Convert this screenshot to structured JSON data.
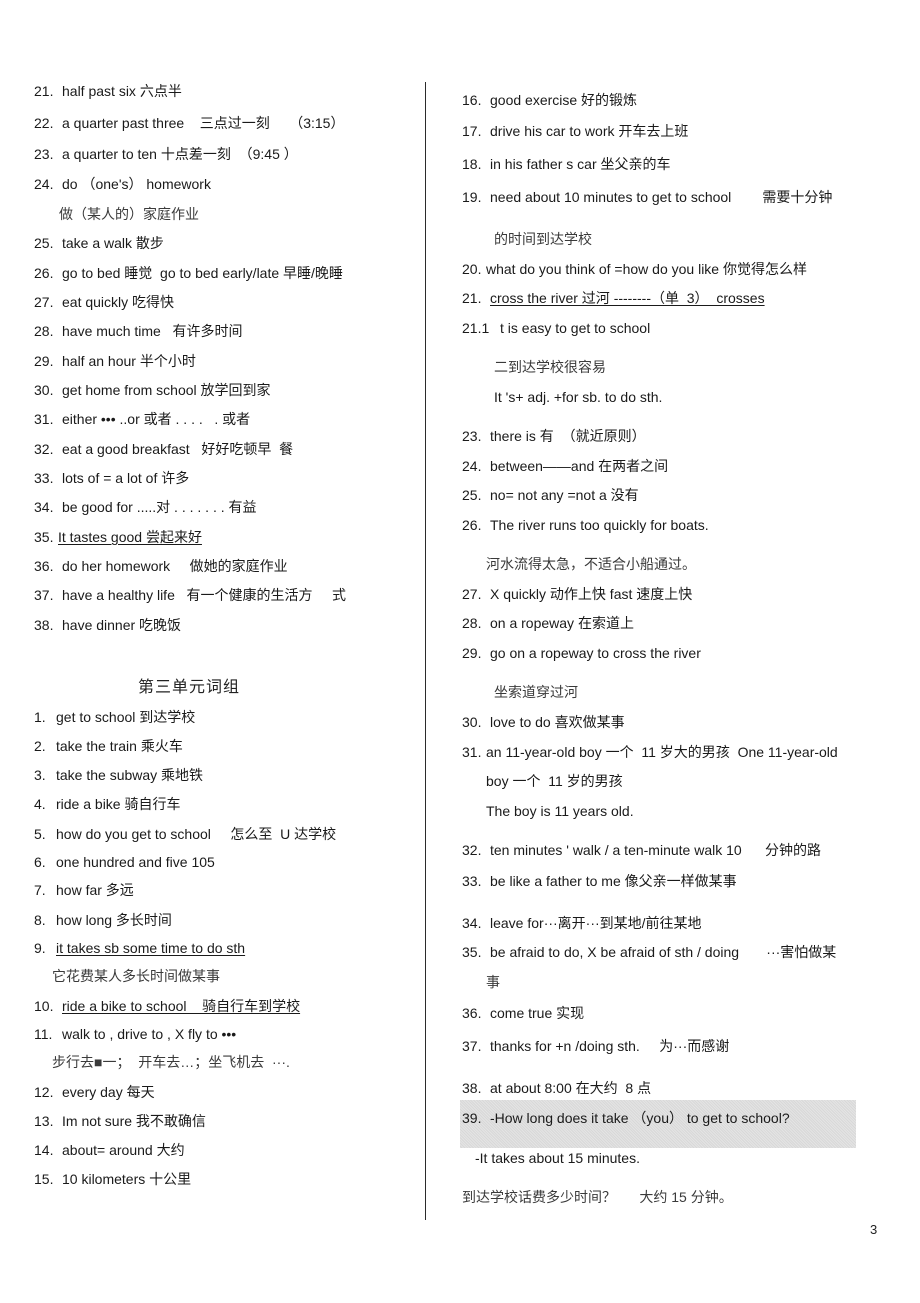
{
  "left_column": {
    "items": [
      {
        "num": "21.",
        "text": "half past six 六点半"
      },
      {
        "num": "22.",
        "text": "a quarter past three    三点过一刻     （3:15）"
      },
      {
        "num": "23.",
        "text": "a quarter to ten 十点差一刻  （9:45 ）"
      },
      {
        "num": "24.",
        "text": "do （one's） homework"
      },
      {
        "num": "",
        "text": "做（某人的）家庭作业"
      },
      {
        "num": "25.",
        "text": "take a walk 散步"
      },
      {
        "num": "26.",
        "text": "go to bed 睡觉  go to bed early/late 早睡/晚睡"
      },
      {
        "num": "27.",
        "text": "eat quickly 吃得快"
      },
      {
        "num": "28.",
        "text": "have much time   有许多时间"
      },
      {
        "num": "29.",
        "text": "half an hour 半个小时"
      },
      {
        "num": "30.",
        "text": "get home from school 放学回到家"
      },
      {
        "num": "31.",
        "text": "either ••• ..or 或者 . . . .   . 或者"
      },
      {
        "num": "32.",
        "text": "eat a good breakfast   好好吃顿早  餐"
      },
      {
        "num": "33.",
        "text": "lots of = a lot of 许多"
      },
      {
        "num": "34.",
        "text": "be good for .....对 . . . . . . . 有益"
      },
      {
        "num": "35.",
        "text": "It tastes good 尝起来好",
        "underline": true
      },
      {
        "num": "36.",
        "text": "do her homework     做她的家庭作业"
      },
      {
        "num": "37.",
        "text": "have a healthy life   有一个健康的生活方     式"
      },
      {
        "num": "38.",
        "text": "have dinner 吃晚饭"
      }
    ],
    "section_title": "第三单元词组",
    "unit_items": [
      {
        "num": "1.",
        "text": "get to school 到达学校"
      },
      {
        "num": "2.",
        "text": "take the train 乘火车"
      },
      {
        "num": "3.",
        "text": "take the subway 乘地铁"
      },
      {
        "num": "4.",
        "text": "ride a bike 骑自行车"
      },
      {
        "num": "5.",
        "text": "how do you get to school     怎么至  U 达学校"
      },
      {
        "num": "6.",
        "text": "one hundred and five 105"
      },
      {
        "num": "7.",
        "text": "how far 多远"
      },
      {
        "num": "8.",
        "text": "how long 多长时间"
      },
      {
        "num": "9.",
        "text": "it takes sb some time to do sth",
        "underline": true
      },
      {
        "num": "",
        "text": "它花费某人多长时间做某事"
      },
      {
        "num": "10.",
        "text": "ride a bike to school    骑自行车到学校",
        "underline": true
      },
      {
        "num": "11.",
        "text": "walk to , drive to , X fly to •••"
      },
      {
        "num": "",
        "text": "步行去■一；  开车去…；坐飞机去  ···."
      },
      {
        "num": "12.",
        "text": "every day 每天"
      },
      {
        "num": "13.",
        "text": "Im not sure 我不敢确信"
      },
      {
        "num": "14.",
        "text": "about= around 大约"
      },
      {
        "num": "15.",
        "text": "10 kilometers 十公里"
      }
    ]
  },
  "right_column": {
    "items": [
      {
        "num": "16.",
        "text": "good exercise 好的锻炼"
      },
      {
        "num": "17.",
        "text": "drive his car to work 开车去上班"
      },
      {
        "num": "18.",
        "text": "in his father s car 坐父亲的车"
      },
      {
        "num": "19.",
        "text": "need about 10 minutes to get to school        需要十分钟"
      },
      {
        "num": "",
        "text": "的时间到达学校"
      },
      {
        "num": "20.",
        "text": "what do you think of =how do you like 你觉得怎么样"
      },
      {
        "num": "21.",
        "text": "cross the river 过河 --------（单  3）  crosses",
        "underline": true
      },
      {
        "num": "21.1",
        "text": "t is easy to get to school"
      },
      {
        "num": "",
        "text": "二到达学校很容易"
      },
      {
        "num": "",
        "text": "It 's+ adj. +for sb. to do sth."
      },
      {
        "num": "23.",
        "text": "there is 有  （就近原则）"
      },
      {
        "num": "24.",
        "text": "between——and 在两者之间"
      },
      {
        "num": "25.",
        "text": "no= not any =not a 没有"
      },
      {
        "num": "26.",
        "text": "The river runs too quickly for boats."
      },
      {
        "num": "",
        "text": "河水流得太急，不适合小船通过。"
      },
      {
        "num": "27.",
        "text": "X quickly 动作上快 fast 速度上快"
      },
      {
        "num": "28.",
        "text": "on a ropeway 在索道上"
      },
      {
        "num": "29.",
        "text": "go on a ropeway to cross the river"
      },
      {
        "num": "",
        "text": "坐索道穿过河"
      },
      {
        "num": "30.",
        "text": "love to do 喜欢做某事"
      },
      {
        "num": "31.",
        "text": "an 11-year-old boy 一个  11 岁大的男孩  One 11-year-old"
      },
      {
        "num": "",
        "text": "boy 一个  11 岁的男孩"
      },
      {
        "num": "",
        "text": "The boy is 11 years old."
      },
      {
        "num": "32.",
        "text": "ten minutes ' walk / a ten-minute walk 10      分钟的路"
      },
      {
        "num": "33.",
        "text": "be like a father to me 像父亲一样做某事"
      },
      {
        "num": "34.",
        "text": "leave for···离开···到某地/前往某地"
      },
      {
        "num": "35.",
        "text": "be afraid to do, X be afraid of sth / doing       ···害怕做某"
      },
      {
        "num": "",
        "text": "事"
      },
      {
        "num": "36.",
        "text": "come true 实现"
      },
      {
        "num": "37.",
        "text": "thanks for +n /doing sth.     为···而感谢"
      },
      {
        "num": "38.",
        "text": "at about 8:00 在大约  8 点"
      },
      {
        "num": "39.",
        "text": "-How long does it take （you） to get to school?"
      },
      {
        "num": "",
        "text": "-It takes about 15 minutes."
      },
      {
        "num": "",
        "text": "到达学校话费多少时间？      大约 15 分钟。"
      }
    ]
  },
  "footer": {
    "page_number": "3"
  }
}
